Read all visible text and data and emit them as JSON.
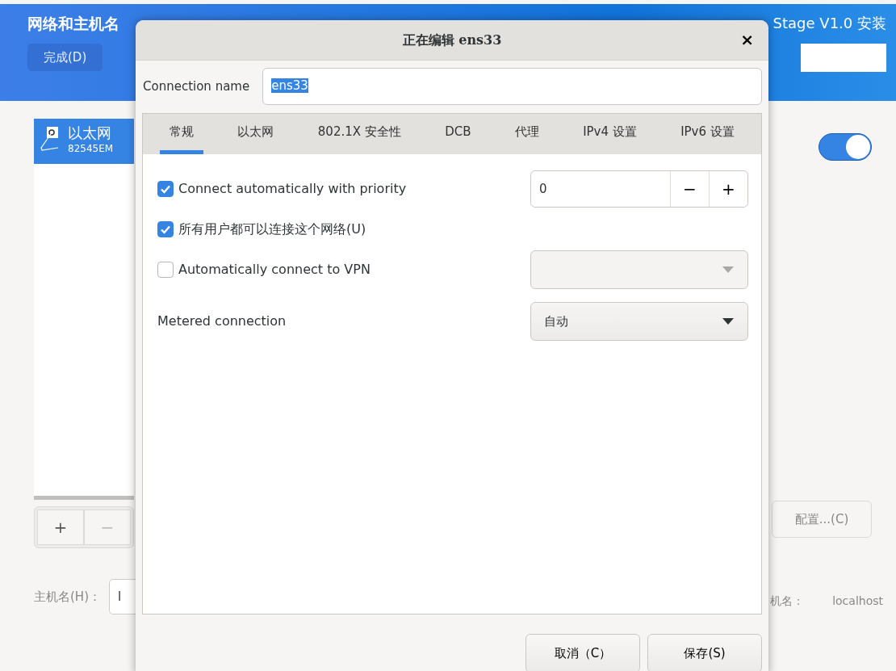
{
  "app": {
    "title": "网络和主机名",
    "product": "Stage V1.0 安装",
    "done_button": "完成(D)"
  },
  "devices": [
    {
      "name": "以太网",
      "detail": "82545EM",
      "selected": true
    }
  ],
  "device_buttons": [
    {
      "label": "+",
      "disabled": false
    },
    {
      "label": "−",
      "disabled": true
    }
  ],
  "device_switch": {
    "on": true
  },
  "configure_button": {
    "label": "配置...(C)"
  },
  "hostname": {
    "label": "主机名(H)：",
    "value": "l"
  },
  "current_hostname": {
    "label": "机名：",
    "value": "localhost"
  },
  "dialog": {
    "title": "正在编辑 ens33",
    "close": "×",
    "connection_name": {
      "label": "Connection name",
      "value": "ens33"
    },
    "tabs": [
      {
        "label": "常规",
        "selected": true
      },
      {
        "label": "以太网",
        "selected": false
      },
      {
        "label": "802.1X 安全性",
        "selected": false
      },
      {
        "label": "DCB",
        "selected": false
      },
      {
        "label": "代理",
        "selected": false
      },
      {
        "label": "IPv4 设置",
        "selected": false
      },
      {
        "label": "IPv6 设置",
        "selected": false
      }
    ],
    "options": [
      {
        "kind": "checkbox",
        "label": "Connect automatically with priority",
        "checked": true,
        "control": {
          "kind": "spin",
          "value": "0",
          "minus": "−",
          "plus": "+"
        }
      },
      {
        "kind": "checkbox",
        "label": "所有用户都可以连接这个网络(U)",
        "checked": true
      },
      {
        "kind": "checkbox",
        "label": "Automatically connect to VPN",
        "checked": false,
        "control": {
          "kind": "combo",
          "disabled": true
        }
      },
      {
        "kind": "label",
        "label": "Metered connection",
        "control": {
          "kind": "combo",
          "value": "自动",
          "disabled": false
        }
      }
    ],
    "buttons": [
      "取消（C）",
      "保存(S)"
    ]
  }
}
